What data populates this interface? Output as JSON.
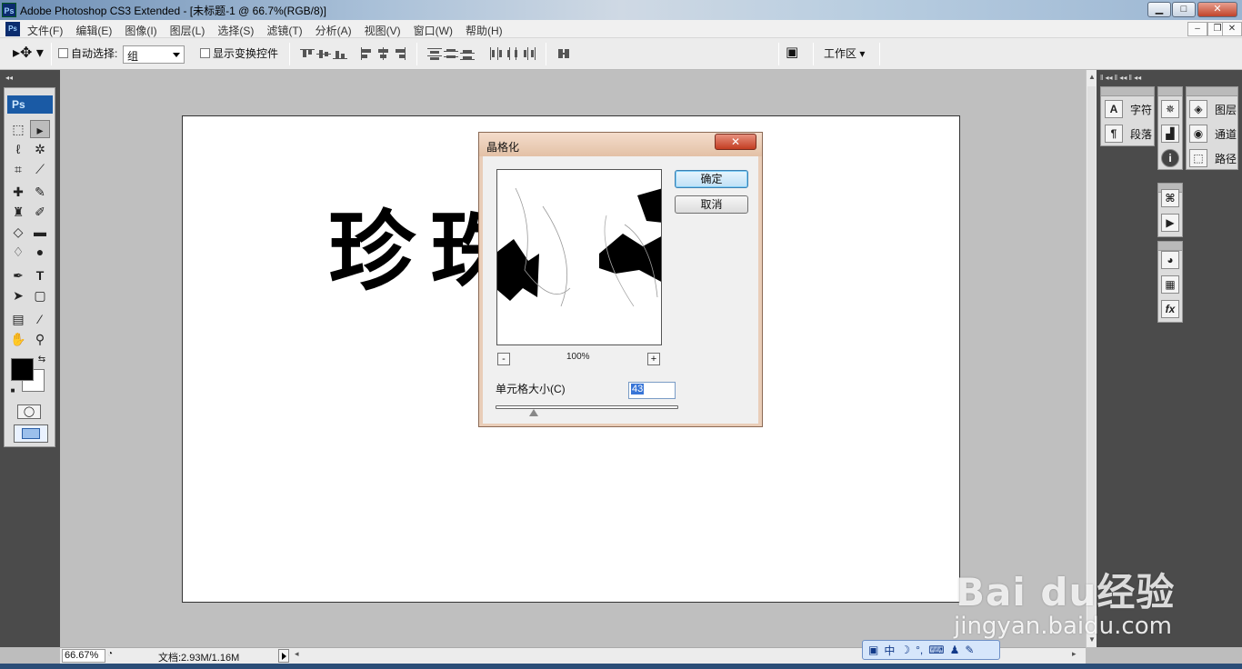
{
  "window": {
    "title": "Adobe Photoshop CS3 Extended - [未标题-1 @ 66.7%(RGB/8)]",
    "minimize": "▁",
    "maximize": "□",
    "close": "✕"
  },
  "menu": {
    "items": [
      "文件(F)",
      "编辑(E)",
      "图像(I)",
      "图层(L)",
      "选择(S)",
      "滤镜(T)",
      "分析(A)",
      "视图(V)",
      "窗口(W)",
      "帮助(H)"
    ],
    "doc_min": "‒",
    "doc_restore": "❐",
    "doc_close": "✕"
  },
  "options": {
    "auto_select_label": "自动选择:",
    "auto_select_value": "组",
    "show_transform_label": "显示变换控件",
    "workspace_label": "工作区"
  },
  "toolbox": {
    "logo": "Ps"
  },
  "panels": {
    "character": "字符",
    "paragraph": "段落",
    "layers": "图层",
    "channels": "通道",
    "paths": "路径"
  },
  "status": {
    "zoom": "66.67%",
    "doc_info": "文档:2.93M/1.16M"
  },
  "ime": {
    "mode": "中"
  },
  "dialog": {
    "title": "晶格化",
    "ok_label": "确定",
    "cancel_label": "取消",
    "zoom_out": "-",
    "zoom_in": "+",
    "zoom_percent": "100%",
    "cell_size_label": "单元格大小(C)",
    "cell_size_value": "43",
    "cell_size_min": 3,
    "cell_size_max": 300
  },
  "canvas": {
    "text": "珍珠之"
  },
  "watermark": {
    "brand": "Bai du经验",
    "url": "jingyan.baidu.com"
  }
}
